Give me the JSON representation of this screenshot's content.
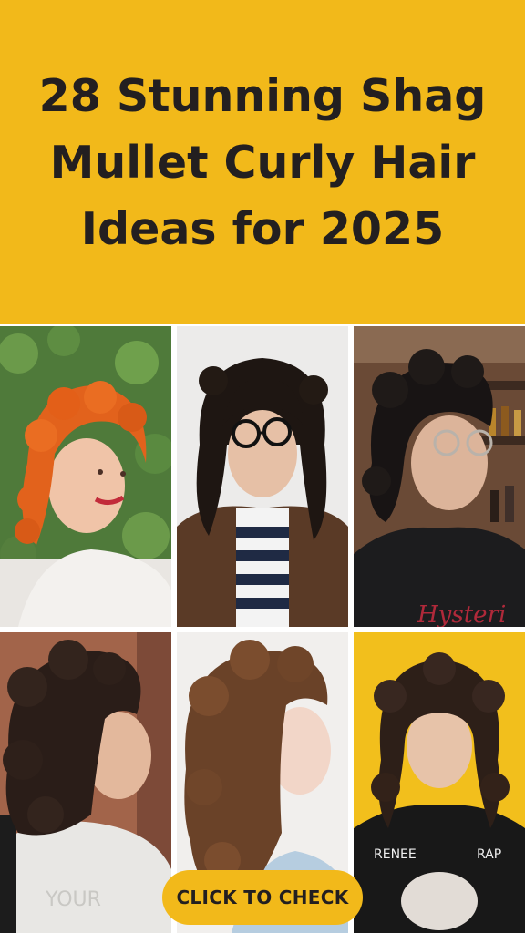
{
  "header": {
    "title_lines": [
      "28 Stunning Shag",
      "Mullet Curly Hair",
      "Ideas for 2025"
    ]
  },
  "photos": [
    {
      "id": "photo-1",
      "subject": "copper curly shag mullet woman smiling, ivy wall background"
    },
    {
      "id": "photo-2",
      "subject": "dark curly shag mullet with round glasses, striped shirt, leather jacket"
    },
    {
      "id": "photo-3",
      "subject": "short dark curly mullet with glasses, black graphic tee, shop shelves"
    },
    {
      "id": "photo-4",
      "subject": "dark curly shag side profile, white tee, brick background"
    },
    {
      "id": "photo-5",
      "subject": "brown wavy shag mullet side profile"
    },
    {
      "id": "photo-6",
      "subject": "dark curly shag with bangs, black graphic tee, yellow wall"
    }
  ],
  "cta": {
    "label": "CLICK TO CHECK"
  },
  "colors": {
    "accent": "#F2B91A",
    "text": "#231F20"
  }
}
